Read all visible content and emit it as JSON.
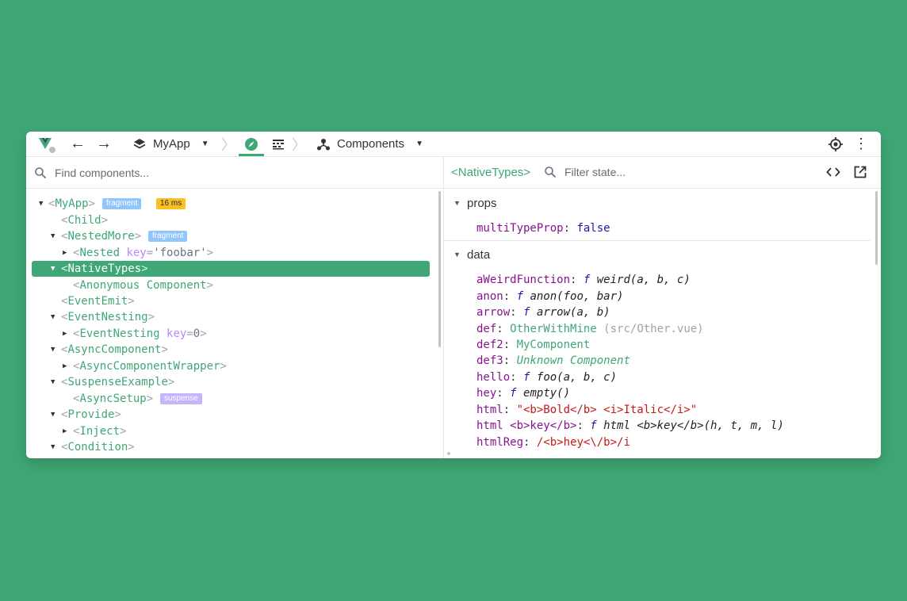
{
  "toolbar": {
    "app_name": "MyApp",
    "view_name": "Components",
    "separator": "〉",
    "more": "⋮",
    "back": "←",
    "forward": "→"
  },
  "search": {
    "placeholder": "Find components..."
  },
  "tree": [
    {
      "tri": "▼",
      "name": "MyApp",
      "badges": [
        "fragment",
        "16 ms"
      ]
    },
    {
      "tri": "",
      "name": "Child"
    },
    {
      "tri": "▼",
      "name": "NestedMore",
      "badges": [
        "fragment"
      ]
    },
    {
      "tri": "▶",
      "name": "Nested",
      "attr_key": "key",
      "attr_val": "'foobar'"
    },
    {
      "tri": "▼",
      "name": "NativeTypes",
      "selected": true
    },
    {
      "tri": "",
      "name": "Anonymous Component"
    },
    {
      "tri": "",
      "name": "EventEmit"
    },
    {
      "tri": "▼",
      "name": "EventNesting"
    },
    {
      "tri": "▶",
      "name": "EventNesting",
      "attr_key": "key",
      "attr_val": "0"
    },
    {
      "tri": "▼",
      "name": "AsyncComponent"
    },
    {
      "tri": "▶",
      "name": "AsyncComponentWrapper"
    },
    {
      "tri": "▼",
      "name": "SuspenseExample"
    },
    {
      "tri": "",
      "name": "AsyncSetup",
      "badges": [
        "suspense"
      ]
    },
    {
      "tri": "▼",
      "name": "Provide"
    },
    {
      "tri": "▶",
      "name": "Inject"
    },
    {
      "tri": "▼",
      "name": "Condition"
    }
  ],
  "inspector": {
    "component": "<NativeTypes>",
    "filter_placeholder": "Filter state...",
    "props_label": "props",
    "data_label": "data",
    "props": [
      {
        "key": "multiTypeProp",
        "value": "false"
      }
    ],
    "data": [
      {
        "key": "aWeirdFunction",
        "f": "f",
        "value": "weird(a, b, c)"
      },
      {
        "key": "anon",
        "f": "f",
        "value": "anon(foo, bar)"
      },
      {
        "key": "arrow",
        "f": "f",
        "value": "arrow(a, b)"
      },
      {
        "key": "def",
        "value": "OtherWithMine",
        "extra": "(src/Other.vue)"
      },
      {
        "key": "def2",
        "value": "MyComponent"
      },
      {
        "key": "def3",
        "value": "Unknown Component"
      },
      {
        "key": "hello",
        "f": "f",
        "value": "foo(a, b, c)"
      },
      {
        "key": "hey",
        "f": "f",
        "value": "empty()"
      },
      {
        "key": "html",
        "value": "\"<b>Bold</b> <i>Italic</i>\""
      },
      {
        "key": "html <b>key</b>",
        "f": "f",
        "value": "html <b>key</b>(h, t, m, l)"
      },
      {
        "key": "htmlReg",
        "value": "/<b>hey<\\/b>/i"
      }
    ]
  },
  "colors": {
    "accent": "#3fa775",
    "fragment": "#93c5fd",
    "timing": "#fbbf24",
    "suspense": "#c4b5fd"
  }
}
